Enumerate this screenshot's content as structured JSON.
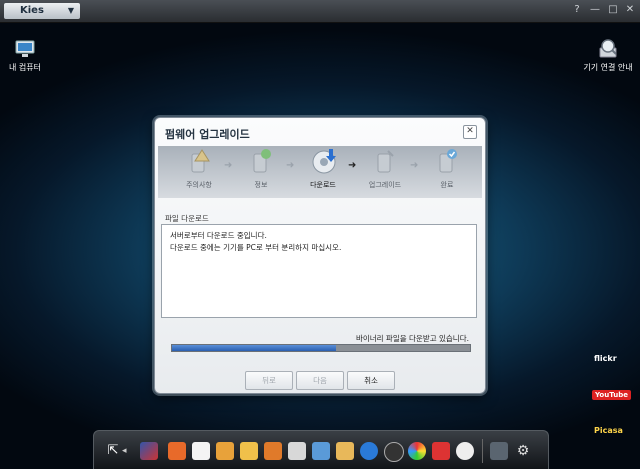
{
  "app": {
    "title": "Kies"
  },
  "window_controls": [
    "?",
    "—",
    "□",
    "✕"
  ],
  "desktop": {
    "my_computer": "내 컴퓨터",
    "connection_guide": "기기 연결 안내"
  },
  "dialog": {
    "title": "펌웨어 업그레이드",
    "steps": [
      {
        "label": "주의사항",
        "icon": "warning-icon"
      },
      {
        "label": "정보",
        "icon": "info-icon"
      },
      {
        "label": "다운로드",
        "icon": "download-disc-icon"
      },
      {
        "label": "업그레이드",
        "icon": "phone-upgrade-icon"
      },
      {
        "label": "완료",
        "icon": "check-icon"
      }
    ],
    "active_step": 2,
    "section_label": "파일 다운로드",
    "log_lines": [
      "서버로부터 다운로드 중입니다.",
      "다운로드 중에는 기기를 PC로 부터 분리하지 마십시오."
    ],
    "status_text": "바이너리 파일을 다운받고 있습니다.",
    "progress": 0.55,
    "buttons": {
      "back": "뒤로",
      "next": "다음",
      "cancel": "취소"
    }
  },
  "side_services": [
    "flickr",
    "YouTube",
    "Picasa"
  ],
  "dock_icons": [
    "external-link-icon",
    "chevron-left-icon",
    "app-tree-icon",
    "phone-icon",
    "calendar-icon",
    "notes-icon",
    "mail-icon",
    "memo-icon",
    "schedule-icon",
    "photos-icon",
    "gallery-icon",
    "music-icon",
    "video-icon",
    "game-icon",
    "shop-icon",
    "podcast-icon",
    "device-icon",
    "settings-icon"
  ]
}
